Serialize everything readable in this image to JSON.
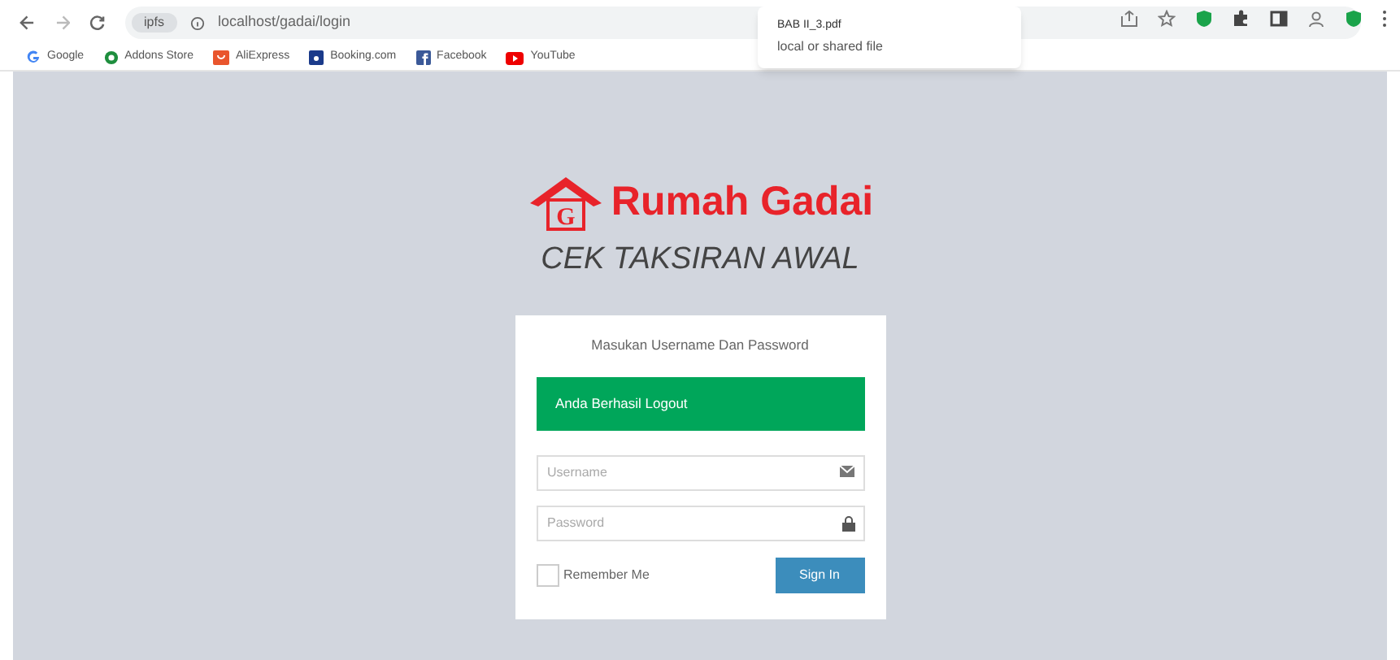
{
  "browser": {
    "chip": "ipfs",
    "url": "localhost/gadai/login",
    "bookmarks": [
      {
        "kind": "google",
        "label": "Google"
      },
      {
        "kind": "addons",
        "label": "Addons Store"
      },
      {
        "kind": "aliexpress",
        "label": "AliExpress"
      },
      {
        "kind": "booking",
        "label": "Booking.com"
      },
      {
        "kind": "facebook",
        "label": "Facebook"
      },
      {
        "kind": "youtube",
        "label": "YouTube"
      }
    ],
    "download_popup": {
      "filename": "BAB II_3.pdf",
      "subtitle": "local or shared file"
    }
  },
  "page": {
    "brand": "Rumah Gadai",
    "logo_letter": "G",
    "subtitle": "CEK TAKSIRAN AWAL",
    "login": {
      "prompt": "Masukan Username Dan Password",
      "alert": "Anda Berhasil Logout",
      "fields": [
        {
          "kind": "user",
          "placeholder": "Username"
        },
        {
          "kind": "password",
          "placeholder": "Password"
        }
      ],
      "remember": {
        "label": "Remember Me",
        "checked": false
      },
      "button": "Sign In"
    }
  }
}
